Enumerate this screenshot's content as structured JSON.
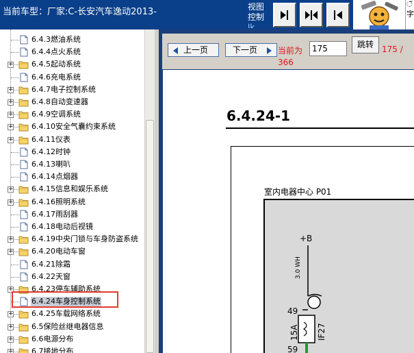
{
  "header": {
    "title": "当前车型：厂家:C-长安汽车逸动2013-",
    "view_line1": "视图",
    "view_line2": "控制",
    "view_line3": "lk",
    "edge_text_1": "ੱ",
    "edge_text_2": "字"
  },
  "tree": {
    "items": [
      {
        "label": "6.4.3燃油系统",
        "expandable": false
      },
      {
        "label": "6.4.4点火系统",
        "expandable": false
      },
      {
        "label": "6.4.5起动系统",
        "expandable": true
      },
      {
        "label": "6.4.6充电系统",
        "expandable": false
      },
      {
        "label": "6.4.7电子控制系统",
        "expandable": true
      },
      {
        "label": "6.4.8自动变速器",
        "expandable": true
      },
      {
        "label": "6.4.9空调系统",
        "expandable": true
      },
      {
        "label": "6.4.10安全气囊约束系统",
        "expandable": true
      },
      {
        "label": "6.4.11仪表",
        "expandable": true
      },
      {
        "label": "6.4.12时钟",
        "expandable": false
      },
      {
        "label": "6.4.13喇叭",
        "expandable": false
      },
      {
        "label": "6.4.14点烟器",
        "expandable": false
      },
      {
        "label": "6.4.15信息和娱乐系统",
        "expandable": true
      },
      {
        "label": "6.4.16照明系统",
        "expandable": true
      },
      {
        "label": "6.4.17雨刮器",
        "expandable": false
      },
      {
        "label": "6.4.18电动后视镜",
        "expandable": false
      },
      {
        "label": "6.4.19中央门锁与车身防盗系统",
        "expandable": true
      },
      {
        "label": "6.4.20电动车窗",
        "expandable": true
      },
      {
        "label": "6.4.21除霜",
        "expandable": false
      },
      {
        "label": "6.4.22天窗",
        "expandable": false
      },
      {
        "label": "6.4.23停车辅助系统",
        "expandable": true
      },
      {
        "label": "6.4.24车身控制系统",
        "expandable": false,
        "selected": true
      },
      {
        "label": "6.4.25车载网络系统",
        "expandable": true
      },
      {
        "label": "6.5保险丝继电器信息",
        "expandable": true
      },
      {
        "label": "6.6电源分布",
        "expandable": true
      },
      {
        "label": "6.7接地分布",
        "expandable": true
      }
    ]
  },
  "nav": {
    "prev_label": "上一页",
    "next_label": "下一页",
    "current_label": "当前为",
    "current_page": "175",
    "jump_label": "跳转",
    "total_line1": "175 /",
    "total_line2": "366"
  },
  "document": {
    "title": "6.4.24-1",
    "module_label": "室内电器中心  P01",
    "supply_label": "+B",
    "wire_label": "3.0 WH",
    "pin_top": "49",
    "pin_bottom": "59",
    "fuse_rating": "15A",
    "fuse_id": "IF27"
  },
  "colors": {
    "header_bg": "#0a3f8a",
    "selection_outline": "#e23a2e",
    "page_text_red": "#e0141e",
    "wire_green": "#1e9e2e"
  }
}
